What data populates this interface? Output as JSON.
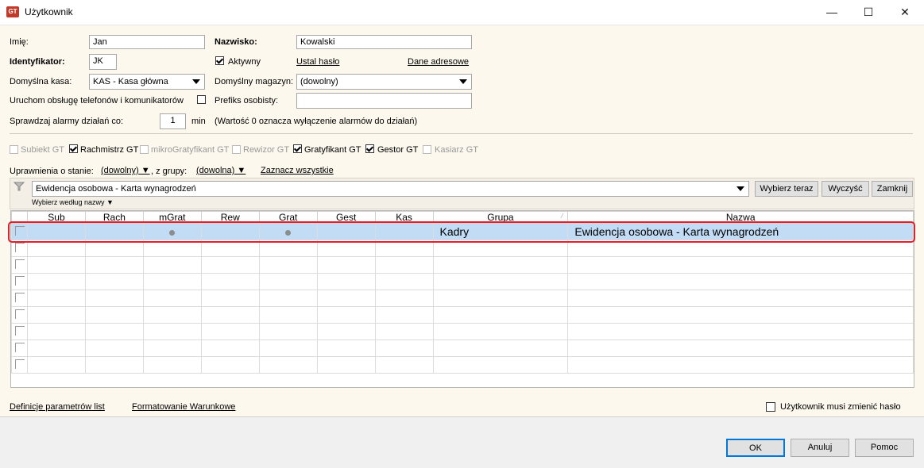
{
  "window": {
    "title": "Użytkownik",
    "minimize_glyph": "—",
    "maximize_glyph": "☐",
    "close_glyph": "✕",
    "app_icon": "GT"
  },
  "form": {
    "imie_label": "Imię:",
    "imie_value": "Jan",
    "nazwisko_label": "Nazwisko:",
    "nazwisko_value": "Kowalski",
    "identyfikator_label": "Identyfikator:",
    "identyfikator_value": "JK",
    "aktywny_label": "Aktywny",
    "ustal_haslo": "Ustal hasło",
    "dane_adresowe": "Dane adresowe",
    "kasa_label": "Domyślna kasa:",
    "kasa_value": "KAS - Kasa główna",
    "magazyn_label": "Domyślny magazyn:",
    "magazyn_value": "(dowolny)",
    "telefony_label": "Uruchom obsługę telefonów i komunikatorów",
    "prefiks_label": "Prefiks osobisty:",
    "prefiks_value": "",
    "alarmy_label": "Sprawdzaj alarmy działań co:",
    "alarmy_value": "1",
    "alarmy_unit": "min",
    "alarmy_hint": "(Wartość 0 oznacza wyłączenie alarmów do działań)"
  },
  "modules": [
    {
      "label": "Subiekt GT",
      "checked": false,
      "enabled": false
    },
    {
      "label": "Rachmistrz GT",
      "checked": true,
      "enabled": true
    },
    {
      "label": "mikroGratyfikant GT",
      "checked": false,
      "enabled": false
    },
    {
      "label": "Rewizor GT",
      "checked": false,
      "enabled": false
    },
    {
      "label": "Gratyfikant GT",
      "checked": true,
      "enabled": true
    },
    {
      "label": "Gestor GT",
      "checked": true,
      "enabled": true
    },
    {
      "label": "Kasiarz GT",
      "checked": false,
      "enabled": false
    }
  ],
  "permissions": {
    "label": "Uprawnienia o stanie:",
    "state_value": "(dowolny)",
    "group_label": ", z grupy:",
    "group_value": "(dowolna)",
    "select_all": "Zaznacz wszystkie",
    "search_value": "Ewidencja osobowa - Karta wynagrodzeń",
    "search_by": "Wybierz według nazwy",
    "btn_select": "Wybierz teraz",
    "btn_clear": "Wyczyść",
    "btn_close": "Zamknij"
  },
  "grid": {
    "columns": [
      "Sub",
      "Rach",
      "mGrat",
      "Rew",
      "Grat",
      "Gest",
      "Kas",
      "Grupa",
      "Nazwa"
    ],
    "row": {
      "mgrat": true,
      "grat": true,
      "grupa": "Kadry",
      "nazwa": "Ewidencja osobowa - Karta wynagrodzeń"
    },
    "empty_rows": 8
  },
  "bottom": {
    "def_params": "Definicje parametrów list",
    "formatting": "Formatowanie Warunkowe",
    "must_change_pw": "Użytkownik musi zmienić hasło"
  },
  "footer": {
    "ok": "OK",
    "cancel": "Anuluj",
    "help": "Pomoc"
  }
}
